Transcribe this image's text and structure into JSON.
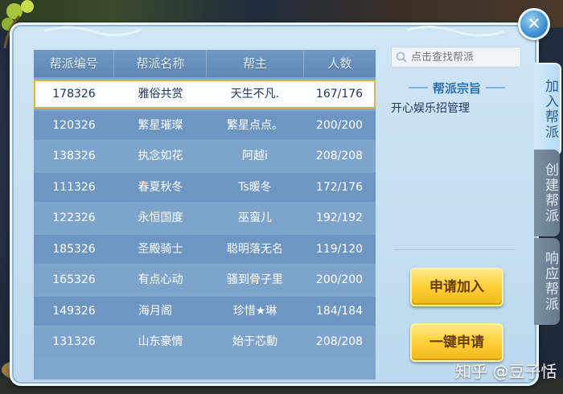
{
  "table": {
    "headers": [
      "帮派编号",
      "帮派名称",
      "帮主",
      "人数"
    ],
    "rows": [
      {
        "id": "178326",
        "name": "雅俗共赏",
        "leader": "天生不凡.",
        "count": "167/176",
        "selected": true
      },
      {
        "id": "120326",
        "name": "繁星璀璨",
        "leader": "繁星点点。",
        "count": "200/200"
      },
      {
        "id": "138326",
        "name": "执念如花",
        "leader": "阿越i",
        "count": "208/208"
      },
      {
        "id": "111326",
        "name": "春夏秋冬",
        "leader": "Ts暖冬",
        "count": "172/176"
      },
      {
        "id": "122326",
        "name": "永恒国度",
        "leader": "巫蛮儿",
        "count": "192/192"
      },
      {
        "id": "185326",
        "name": "圣殿骑士",
        "leader": "聪明落无名",
        "count": "119/120"
      },
      {
        "id": "165326",
        "name": "有点心动",
        "leader": "骚到骨子里",
        "count": "200/200"
      },
      {
        "id": "149326",
        "name": "海月阁ㅤ",
        "leader": "珍惜★琳",
        "count": "184/184"
      },
      {
        "id": "131326",
        "name": "山东豪情",
        "leader": "始于芯動",
        "count": "208/208"
      }
    ]
  },
  "search": {
    "placeholder": "点击查找帮派"
  },
  "motto": {
    "title": "帮派宗旨",
    "text": "开心娱乐招管理"
  },
  "buttons": {
    "apply": "申请加入",
    "one_click": "一键申请"
  },
  "tabs": {
    "join": "加入帮派",
    "create": "创建帮派",
    "respond": "响应帮派"
  },
  "close_label": "✕",
  "watermark": "知乎 @豆子恬",
  "colors": {
    "accent": "#2d6fae",
    "gold": "#ffd23a",
    "selected_border": "#d8b44a"
  }
}
